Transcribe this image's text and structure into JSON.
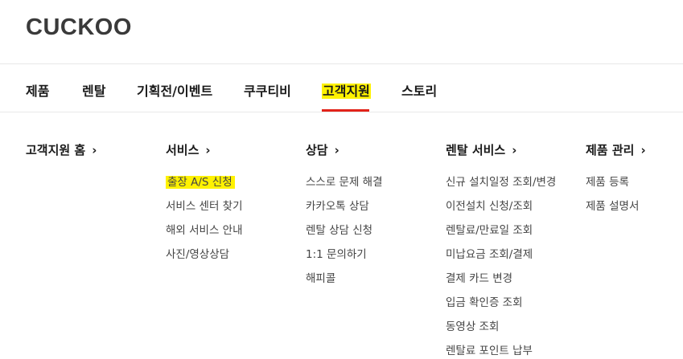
{
  "brand": {
    "logo_text": "CUCKOO"
  },
  "gnb": {
    "items": [
      {
        "label": "제품"
      },
      {
        "label": "렌탈"
      },
      {
        "label": "기획전/이벤트"
      },
      {
        "label": "쿠쿠티비"
      },
      {
        "label": "고객지원",
        "active": true
      },
      {
        "label": "스토리"
      }
    ],
    "accent_color": "#e2231a",
    "highlight_color": "#fff200"
  },
  "menu": {
    "columns": [
      {
        "title": "고객지원 홈",
        "items": []
      },
      {
        "title": "서비스",
        "items": [
          "출장 A/S 신청",
          "서비스 센터 찾기",
          "해외 서비스 안내",
          "사진/영상상담"
        ]
      },
      {
        "title": "상담",
        "items": [
          "스스로 문제 해결",
          "카카오톡 상담",
          "렌탈 상담 신청",
          "1:1 문의하기",
          "해피콜"
        ]
      },
      {
        "title": "렌탈 서비스",
        "items": [
          "신규 설치일정 조회/변경",
          "이전설치 신청/조회",
          "렌탈료/만료일 조회",
          "미납요금 조회/결제",
          "결제 카드 변경",
          "입금 확인증 조회",
          "동영상 조회",
          "렌탈료 포인트 납부"
        ]
      },
      {
        "title": "제품 관리",
        "items": [
          "제품 등록",
          "제품 설명서"
        ]
      }
    ],
    "chevron": "›"
  }
}
